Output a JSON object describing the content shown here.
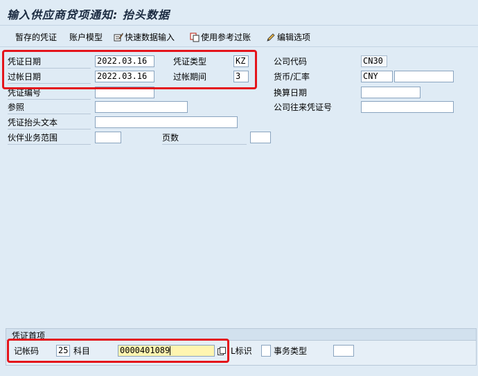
{
  "window": {
    "title": "输入供应商贷项通知: 抬头数据"
  },
  "toolbar": {
    "items": [
      {
        "label": "暂存的凭证",
        "icon": ""
      },
      {
        "label": "账户模型",
        "icon": ""
      },
      {
        "label": "快速数据输入",
        "icon": "quick-entry-icon"
      },
      {
        "label": "使用参考过账",
        "icon": "reference-icon"
      },
      {
        "label": "编辑选项",
        "icon": "pencil-icon"
      }
    ]
  },
  "header": {
    "doc_date": {
      "label": "凭证日期",
      "value": "2022.03.16"
    },
    "doc_type": {
      "label": "凭证类型",
      "value": "KZ"
    },
    "company_code": {
      "label": "公司代码",
      "value": "CN30"
    },
    "posting_date": {
      "label": "过帐日期",
      "value": "2022.03.16"
    },
    "period": {
      "label": "过帐期间",
      "value": "3"
    },
    "currency": {
      "label": "货币/汇率",
      "value": "CNY",
      "rate": ""
    },
    "doc_number": {
      "label": "凭证编号",
      "value": ""
    },
    "translation_date": {
      "label": "换算日期",
      "value": ""
    },
    "reference": {
      "label": "参照",
      "value": ""
    },
    "intercompany": {
      "label": "公司往来凭证号",
      "value": ""
    },
    "header_text": {
      "label": "凭证抬头文本",
      "value": ""
    },
    "trading_partner": {
      "label": "伙伴业务范围",
      "value": ""
    },
    "pages": {
      "label": "页数",
      "value": ""
    }
  },
  "first_item": {
    "title": "凭证首项",
    "posting_key": {
      "label": "记帐码",
      "value": "25"
    },
    "account": {
      "label": "科目",
      "value": "0000401089"
    },
    "sgl_ind": {
      "label": "L标识",
      "value": ""
    },
    "trans_type": {
      "label": "事务类型",
      "value": ""
    }
  },
  "colors": {
    "background": "#dfebf5",
    "highlight": "#e4141b",
    "focus_field": "#fff5b0"
  }
}
